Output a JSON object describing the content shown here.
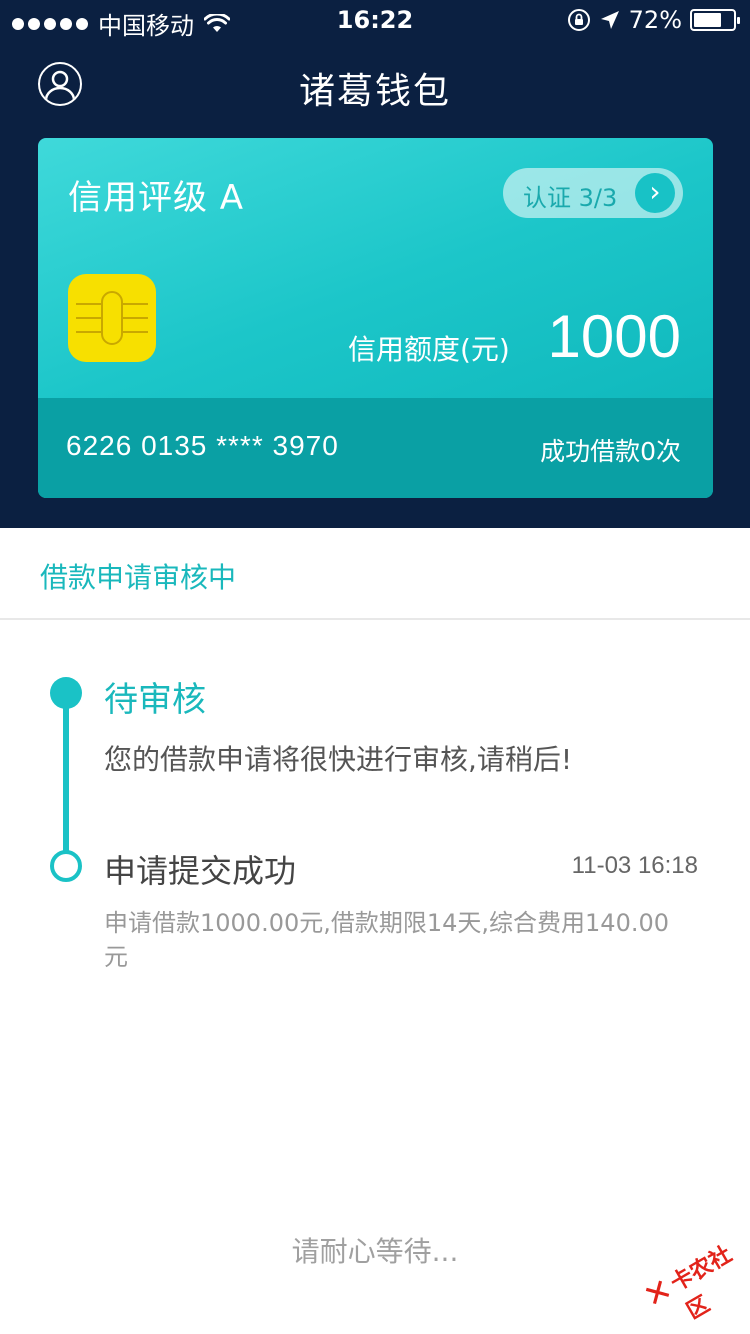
{
  "status_bar": {
    "carrier": "中国移动",
    "time": "16:22",
    "battery_percent_label": "72%",
    "battery_level": 0.72
  },
  "nav": {
    "title": "诸葛钱包",
    "profile_icon": "user-circle-icon"
  },
  "card": {
    "rating": "信用评级 A",
    "verify_label": "认证 3/3",
    "verify_arrow": "›",
    "limit_label": "信用额度(元)",
    "limit_value": "1000",
    "card_number": "6226 0135 **** 3970",
    "loan_count": "成功借款0次"
  },
  "section": {
    "title": "借款申请审核中"
  },
  "timeline": [
    {
      "title": "待审核",
      "desc": "您的借款申请将很快进行审核,请稍后!"
    },
    {
      "title": "申请提交成功",
      "time": "11-03 16:18",
      "desc": "申请借款1000.00元,借款期限14天,综合费用140.00元"
    }
  ],
  "footer": {
    "wait_text": "请耐心等待..."
  },
  "watermark": {
    "text": "卡农社区"
  },
  "colors": {
    "top_bg": "#0b2041",
    "accent": "#1ac2c6",
    "chip": "#f7e000",
    "watermark": "#e2231a"
  }
}
